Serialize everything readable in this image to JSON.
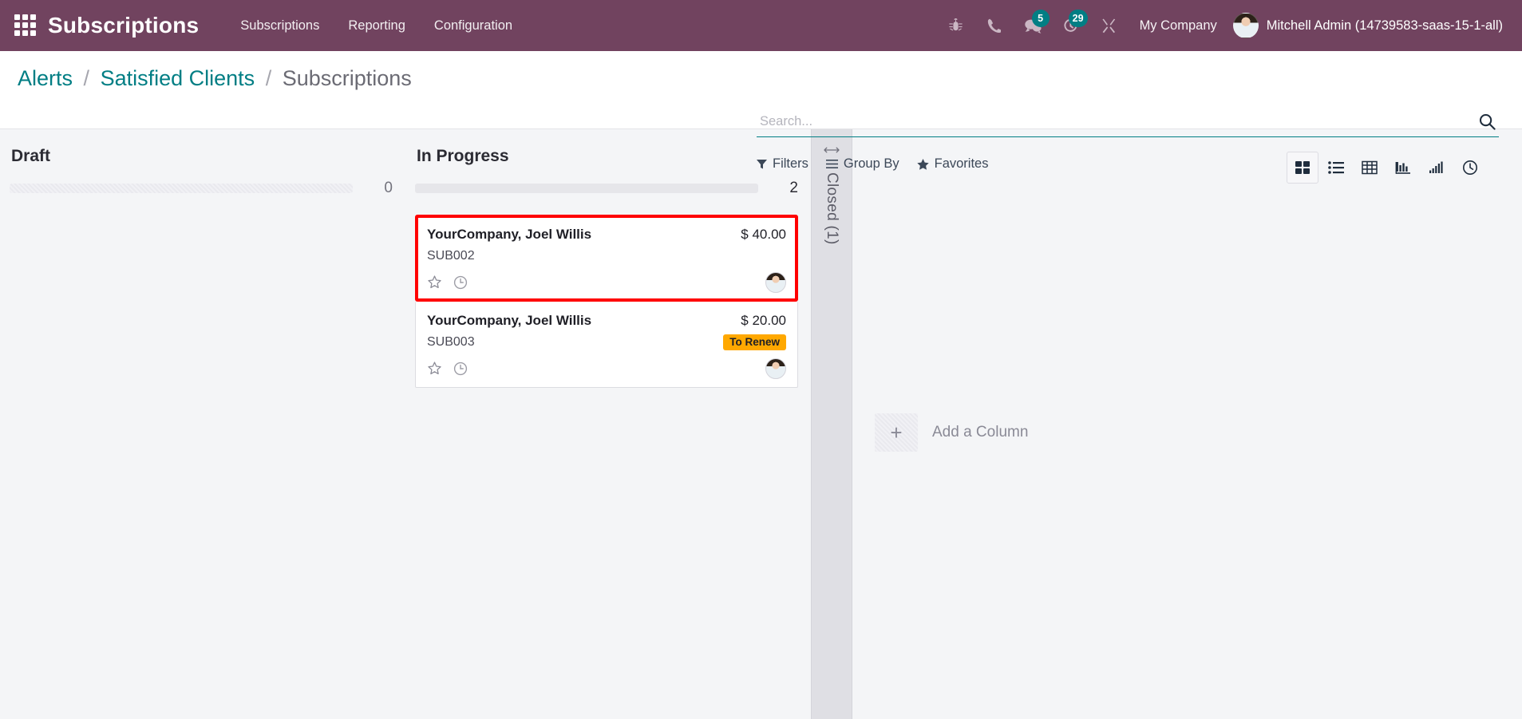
{
  "navbar": {
    "apps_icon": "apps-grid-icon",
    "brand": "Subscriptions",
    "menu": [
      {
        "label": "Subscriptions"
      },
      {
        "label": "Reporting"
      },
      {
        "label": "Configuration"
      }
    ],
    "sys_icons": [
      {
        "name": "bug-icon",
        "badge": null
      },
      {
        "name": "phone-icon",
        "badge": null
      },
      {
        "name": "messages-icon",
        "badge": "5"
      },
      {
        "name": "activities-clock-icon",
        "badge": "29"
      },
      {
        "name": "tools-icon",
        "badge": null
      }
    ],
    "company": "My Company",
    "user": "Mitchell Admin (14739583-saas-15-1-all)",
    "colors": {
      "background": "#71435F",
      "badge": "#017e84"
    }
  },
  "control_panel": {
    "breadcrumb": [
      {
        "label": "Alerts",
        "current": false
      },
      {
        "label": "Satisfied Clients",
        "current": false
      },
      {
        "label": "Subscriptions",
        "current": true
      }
    ],
    "breadcrumb_separator": "/",
    "search": {
      "placeholder": "Search...",
      "value": "",
      "icon": "search-icon"
    },
    "filters": [
      {
        "label": "Filters",
        "icon": "funnel-icon"
      },
      {
        "label": "Group By",
        "icon": "list-lines-icon"
      },
      {
        "label": "Favorites",
        "icon": "star-icon"
      }
    ],
    "views": [
      {
        "name": "kanban-view",
        "icon": "kanban-icon",
        "active": true
      },
      {
        "name": "list-view",
        "icon": "list-icon",
        "active": false
      },
      {
        "name": "pivot-view",
        "icon": "table-icon",
        "active": false
      },
      {
        "name": "graph-view",
        "icon": "bar-chart-icon",
        "active": false
      },
      {
        "name": "cohort-view",
        "icon": "ascending-bars-icon",
        "active": false
      },
      {
        "name": "activity-view",
        "icon": "clock-icon",
        "active": false
      }
    ]
  },
  "kanban": {
    "columns": [
      {
        "title": "Draft",
        "count": "0",
        "progress_style": "dotted",
        "cards": []
      },
      {
        "title": "In Progress",
        "count": "2",
        "progress_style": "solid",
        "cards": [
          {
            "name": "YourCompany, Joel Willis",
            "amount": "$ 40.00",
            "reference": "SUB002",
            "tag": null,
            "highlighted": true,
            "icons": [
              "star-icon",
              "clock-icon"
            ],
            "avatar": "user-avatar"
          },
          {
            "name": "YourCompany, Joel Willis",
            "amount": "$ 20.00",
            "reference": "SUB003",
            "tag": "To Renew",
            "highlighted": false,
            "icons": [
              "star-icon",
              "clock-icon"
            ],
            "avatar": "user-avatar"
          }
        ]
      }
    ],
    "folded_column": {
      "title": "Closed (1)",
      "arrow_icon": "arrows-horizontal-icon"
    },
    "add_column": {
      "label": "Add a Column",
      "plus": "+"
    },
    "colors": {
      "highlight_border": "#ff0000",
      "tag_background": "#ffa800",
      "background": "#f4f5f7"
    }
  }
}
